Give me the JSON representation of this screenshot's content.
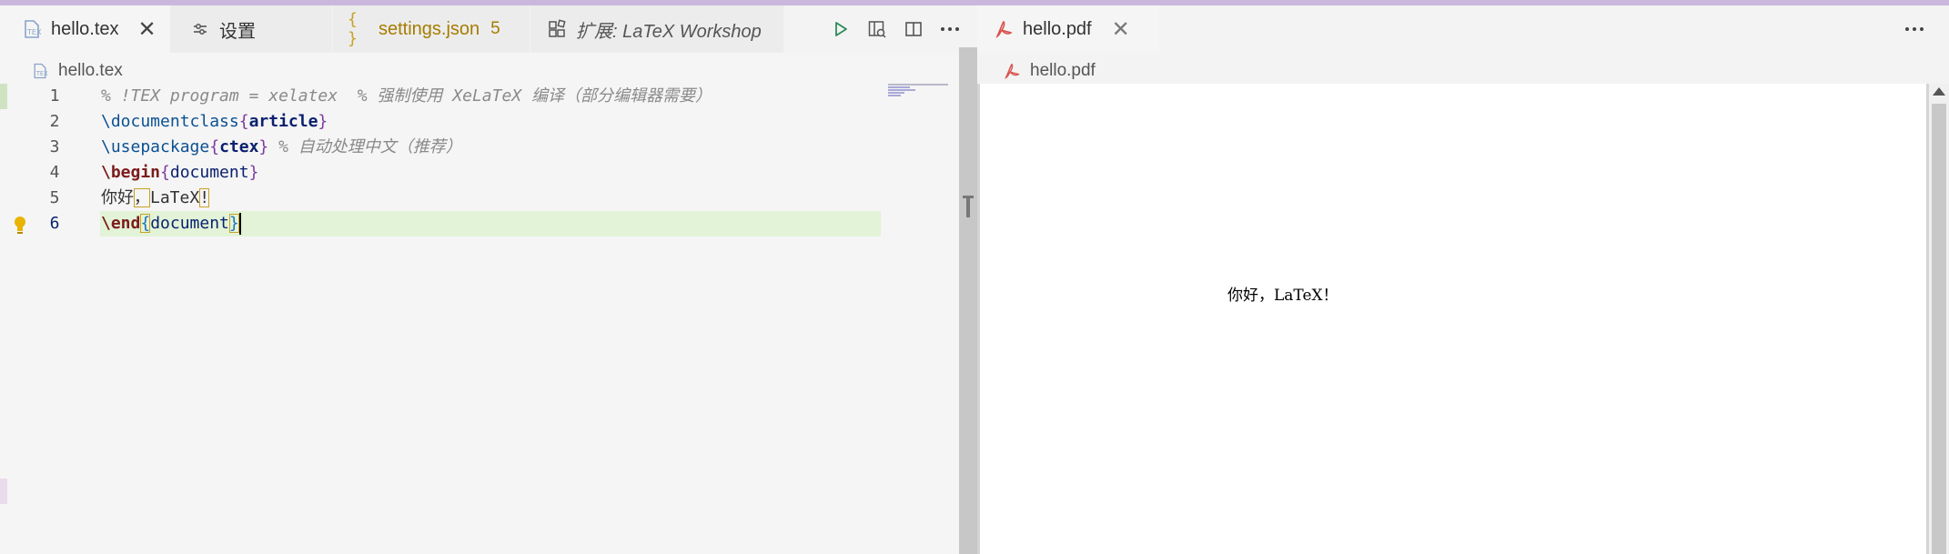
{
  "left_tabs": [
    {
      "label": "hello.tex",
      "close": "✕"
    },
    {
      "label": "设置"
    },
    {
      "label": "settings.json",
      "badge": "5"
    },
    {
      "label": "扩展: LaTeX Workshop"
    }
  ],
  "breadcrumb": {
    "file": "hello.tex"
  },
  "editor": {
    "lines": [
      {
        "num": "1",
        "comment": "% !TEX program = xelatex  % 强制使用 XeLaTeX 编译（部分编辑器需要）"
      },
      {
        "num": "2",
        "cmd": "\\documentclass",
        "open": "{",
        "arg": "article",
        "close": "}"
      },
      {
        "num": "3",
        "cmd": "\\usepackage",
        "open": "{",
        "arg": "ctex",
        "close": "}",
        "comment": " % 自动处理中文（推荐）"
      },
      {
        "num": "4",
        "cmd": "\\begin",
        "open": "{",
        "arg": "document",
        "close": "}"
      },
      {
        "num": "5",
        "t1": "你好",
        "t2": "，",
        "t3": "LaTeX",
        "t4": "!"
      },
      {
        "num": "6",
        "cmd": "\\end",
        "open": "{",
        "arg": "document",
        "close": "}"
      }
    ]
  },
  "right": {
    "tab_label": "hello.pdf",
    "tab_close": "✕",
    "breadcrumb": "hello.pdf",
    "pdf_text": "你好，LaTeX！"
  },
  "icons": {
    "tex": "tex-file-icon",
    "settings": "settings-sliders-icon",
    "json": "json-braces-icon",
    "extension": "extension-icon",
    "run": "run-icon",
    "preview": "preview-icon",
    "split": "split-editor-icon",
    "more": "more-icon",
    "pdf": "pdf-icon",
    "bulb": "lightbulb-icon"
  },
  "colors": {
    "accent_line": "#c9b8dc",
    "current_line": "#e2f3d7",
    "warning": "#a67c00",
    "pdf_icon": "#d9534f",
    "run": "#2e8b57"
  }
}
